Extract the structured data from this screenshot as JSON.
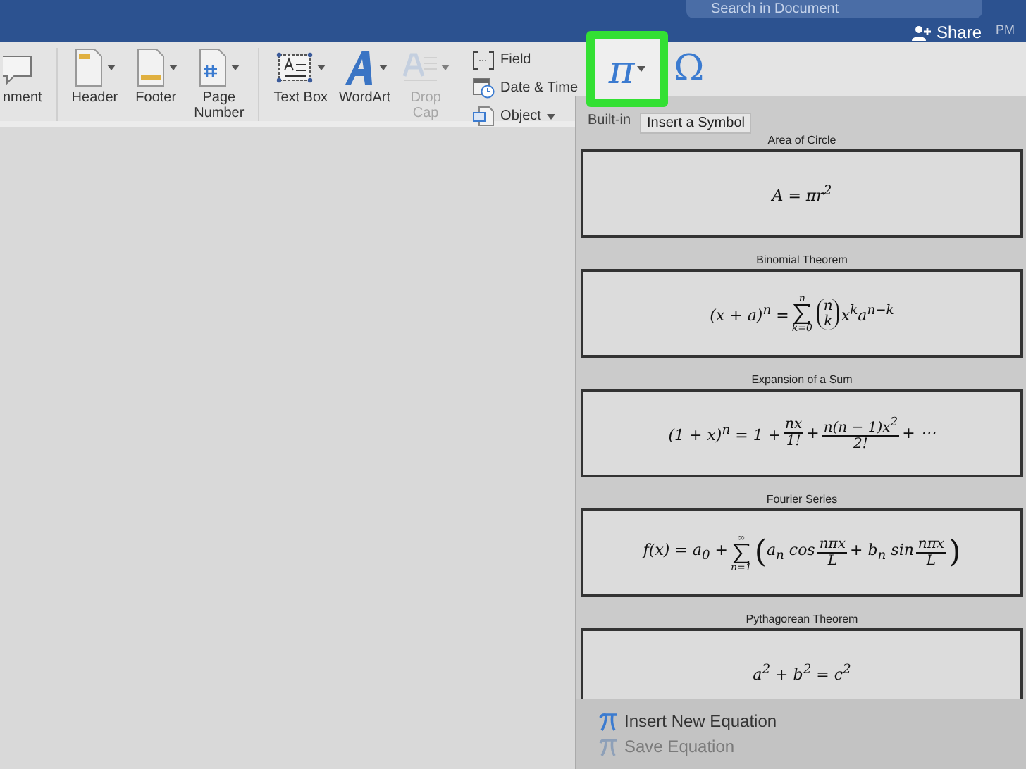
{
  "title_bar": {
    "search": {
      "placeholder": "Search in Document"
    },
    "share_button": "Share",
    "clock": "PM"
  },
  "ribbon": {
    "large_items": [
      {
        "lines": [
          "nment"
        ],
        "menu": false,
        "disabled": false
      },
      {
        "lines": [
          "Header"
        ],
        "menu": true,
        "disabled": false
      },
      {
        "lines": [
          "Footer"
        ],
        "menu": true,
        "disabled": false
      },
      {
        "lines": [
          "Page",
          "Number"
        ],
        "menu": true,
        "disabled": false
      },
      {
        "lines": [
          "Text Box"
        ],
        "menu": true,
        "disabled": false
      },
      {
        "lines": [
          "WordArt"
        ],
        "menu": true,
        "disabled": false
      },
      {
        "lines": [
          "Drop",
          "Cap"
        ],
        "menu": true,
        "disabled": true
      }
    ],
    "small_items": [
      {
        "label": "Field",
        "menu": false
      },
      {
        "label": "Date & Time",
        "menu": false
      },
      {
        "label": "Object",
        "menu": true
      }
    ],
    "equation_button": {
      "symbol": "π",
      "highlighted": true,
      "menu": true
    },
    "symbol_button": {
      "symbol": "Ω"
    }
  },
  "equation_panel": {
    "heading": "Built-in",
    "tooltip": "Insert a Symbol",
    "equations": [
      {
        "name": "Area of Circle",
        "parts": [
          {
            "kind": "text",
            "text": "A = πr$^{2}$"
          }
        ]
      },
      {
        "name": "Binomial Theorem",
        "parts": [
          {
            "kind": "text",
            "text": "(x + a)$^{n}$ = "
          },
          {
            "kind": "sum",
            "upper": "n",
            "lower": "k=0"
          },
          {
            "kind": "binom",
            "top": "n",
            "bottom": "k"
          },
          {
            "kind": "text",
            "text": "x$^{k}$a$^{n−k}$"
          }
        ]
      },
      {
        "name": "Expansion of a Sum",
        "parts": [
          {
            "kind": "text",
            "text": "(1 + x)$^{n}$ = 1 + "
          },
          {
            "kind": "frac",
            "num": "nx",
            "den": "1!"
          },
          {
            "kind": "text",
            "text": " + "
          },
          {
            "kind": "frac",
            "num": "n(n − 1)x$^{2}$",
            "den": "2!"
          },
          {
            "kind": "text",
            "text": " + ⋯"
          }
        ]
      },
      {
        "name": "Fourier Series",
        "parts": [
          {
            "kind": "text",
            "text": "f(x) = a$_{0}$ + "
          },
          {
            "kind": "sum",
            "upper": "∞",
            "lower": "n=1"
          },
          {
            "kind": "big",
            "text": "("
          },
          {
            "kind": "text",
            "text": "a$_{n}$ cos"
          },
          {
            "kind": "frac",
            "num": "nπx",
            "den": "L"
          },
          {
            "kind": "text",
            "text": " + b$_{n}$ sin"
          },
          {
            "kind": "frac",
            "num": "nπx",
            "den": "L"
          },
          {
            "kind": "big",
            "text": ")"
          }
        ]
      },
      {
        "name": "Pythagorean Theorem",
        "parts": [
          {
            "kind": "text",
            "text": "a$^{2}$ + b$^{2}$ = c$^{2}$"
          }
        ]
      }
    ],
    "commands": [
      {
        "label": "Insert New Equation",
        "disabled": false
      },
      {
        "label": "Save Equation",
        "disabled": true
      }
    ]
  }
}
